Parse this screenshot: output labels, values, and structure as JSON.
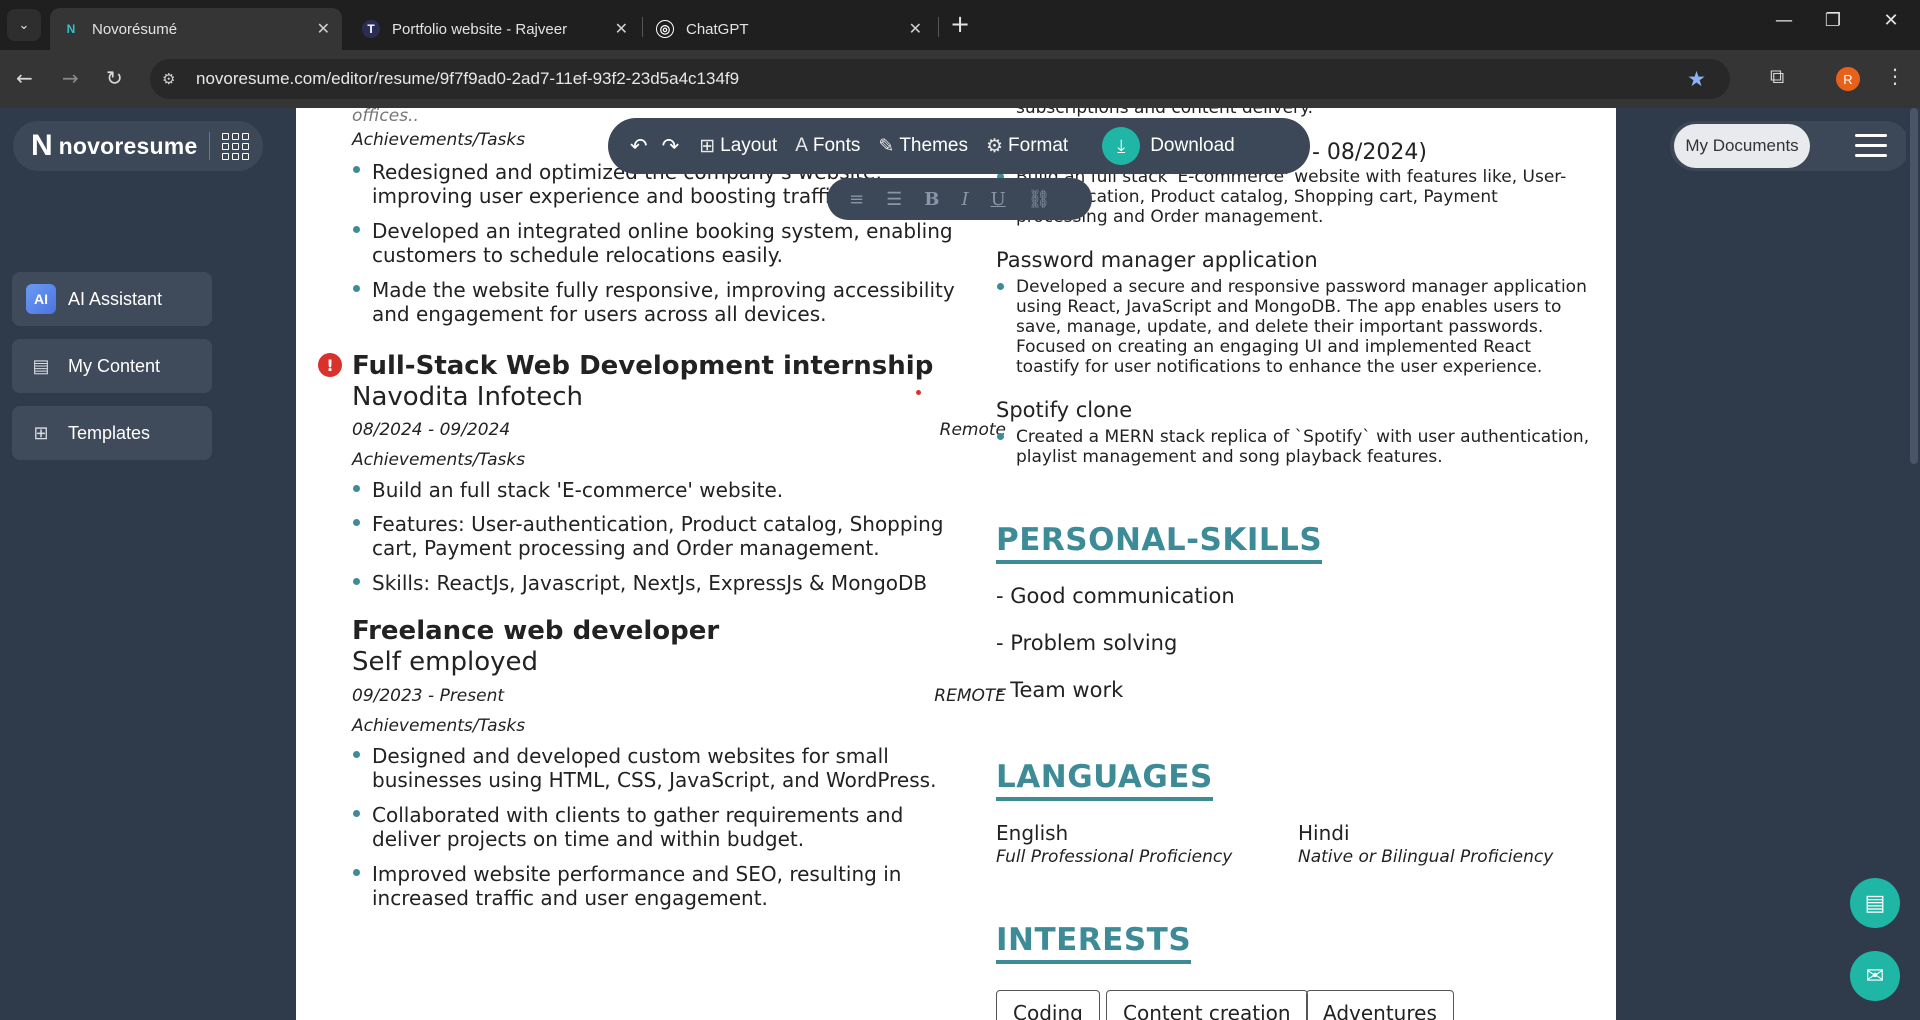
{
  "browser": {
    "tabs": [
      {
        "title": "Novorésumé",
        "favicon": "N"
      },
      {
        "title": "Portfolio website - Rajveer",
        "favicon": "T"
      },
      {
        "title": "ChatGPT",
        "favicon": "◎"
      }
    ],
    "url": "novoresume.com/editor/resume/9f7f9ad0-2ad7-11ef-93f2-23d5a4c134f9",
    "profile_initial": "R"
  },
  "app": {
    "brand": "novoresume",
    "sidebar": [
      {
        "label": "AI Assistant",
        "icon": "ai-assistant-icon"
      },
      {
        "label": "My Content",
        "icon": "content-icon"
      },
      {
        "label": "Templates",
        "icon": "templates-icon"
      }
    ],
    "my_documents": "My Documents"
  },
  "toolbar": {
    "layout": "Layout",
    "fonts": "Fonts",
    "themes": "Themes",
    "format": "Format",
    "download": "Download"
  },
  "resume": {
    "top_fragment": "offices..",
    "job0": {
      "achievements_label": "Achievements/Tasks",
      "bullets": [
        "Redesigned and optimized the company's website,",
        "improving user experience and boosting traffic by",
        "Developed an integrated online booking system, enabling",
        "customers to schedule relocations easily.",
        "Made the website fully responsive, improving accessibility",
        "and engagement for users across all devices."
      ]
    },
    "job1": {
      "title": "Full-Stack Web Development internship",
      "company": "Navodita Infotech",
      "dates": "08/2024 - 09/2024",
      "location": "Remote",
      "achievements_label": "Achievements/Tasks",
      "bullets": [
        "Build an full stack 'E-commerce' website.",
        "Features: User-authentication, Product catalog, Shopping",
        "cart, Payment processing and Order management.",
        "Skills: ReactJs, Javascript, NextJs, ExpressJs & MongoDB"
      ]
    },
    "job2": {
      "title": "Freelance web developer",
      "company": "Self employed",
      "dates": "09/2023 - Present",
      "location": "REMOTE",
      "achievements_label": "Achievements/Tasks",
      "bullets": [
        "Designed and developed custom websites for small",
        "businesses using HTML, CSS, JavaScript, and WordPress.",
        "Collaborated with clients to gather requirements and",
        "deliver projects on time and within budget.",
        "Improved website performance and SEO, resulting in",
        "increased traffic and user engagement."
      ]
    },
    "projects": {
      "top_fragment": "subscriptions and content delivery.",
      "top_dates_fragment": "- 08/2024)",
      "ecom_lines": [
        "Build an full stack 'E-commerce' website with features like, User-",
        "authentication, Product catalog, Shopping cart, Payment",
        "processing and Order management."
      ],
      "password_title": "Password manager application",
      "password_lines": [
        "Developed a secure and responsive password manager application",
        "using React, JavaScript and MongoDB. The app enables users to",
        "save, manage, update, and delete their important passwords.",
        "Focused on creating an engaging UI and implemented React",
        "toastify for user notifications to enhance the user experience."
      ],
      "spotify_title": "Spotify clone",
      "spotify_lines": [
        "Created a MERN stack replica of `Spotify` with user authentication,",
        "playlist management and song playback features."
      ]
    },
    "skills": {
      "heading": "PERSONAL-SKILLS",
      "items": [
        "- Good communication",
        "- Problem solving",
        "- Team work"
      ]
    },
    "languages": {
      "heading": "LANGUAGES",
      "items": [
        {
          "name": "English",
          "level": "Full Professional Proficiency"
        },
        {
          "name": "Hindi",
          "level": "Native or Bilingual Proficiency"
        }
      ]
    },
    "interests": {
      "heading": "INTERESTS",
      "items": [
        "Coding",
        "Content creation",
        "Adventures"
      ]
    }
  },
  "colors": {
    "accent": "#3d8b96",
    "sidebar_bg": "#2f3b4a",
    "download": "#1fb6a6",
    "warning": "#d9322c"
  }
}
